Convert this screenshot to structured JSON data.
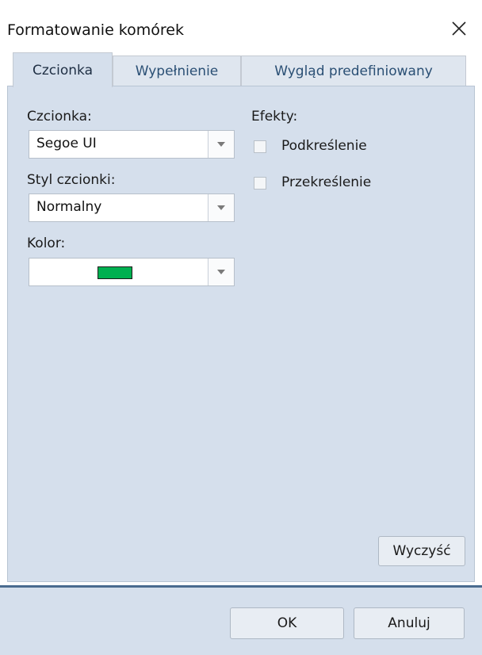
{
  "window": {
    "title": "Formatowanie komórek",
    "close_symbol": "✕"
  },
  "tabs": [
    {
      "label": "Czcionka",
      "active": true
    },
    {
      "label": "Wypełnienie",
      "active": false
    },
    {
      "label": "Wygląd predefiniowany",
      "active": false
    }
  ],
  "font": {
    "font_label": "Czcionka:",
    "font_value": "Segoe UI",
    "style_label": "Styl czcionki:",
    "style_value": "Normalny",
    "color_label": "Kolor:",
    "color_value": "#00b050"
  },
  "effects": {
    "label": "Efekty:",
    "underline_label": "Podkreślenie",
    "underline_checked": false,
    "strikethrough_label": "Przekreślenie",
    "strikethrough_checked": false
  },
  "buttons": {
    "clear": "Wyczyść",
    "ok": "OK",
    "cancel": "Anuluj"
  },
  "colors": {
    "panel_background": "#d5dfec",
    "footer_separator": "#4a6b8f"
  }
}
